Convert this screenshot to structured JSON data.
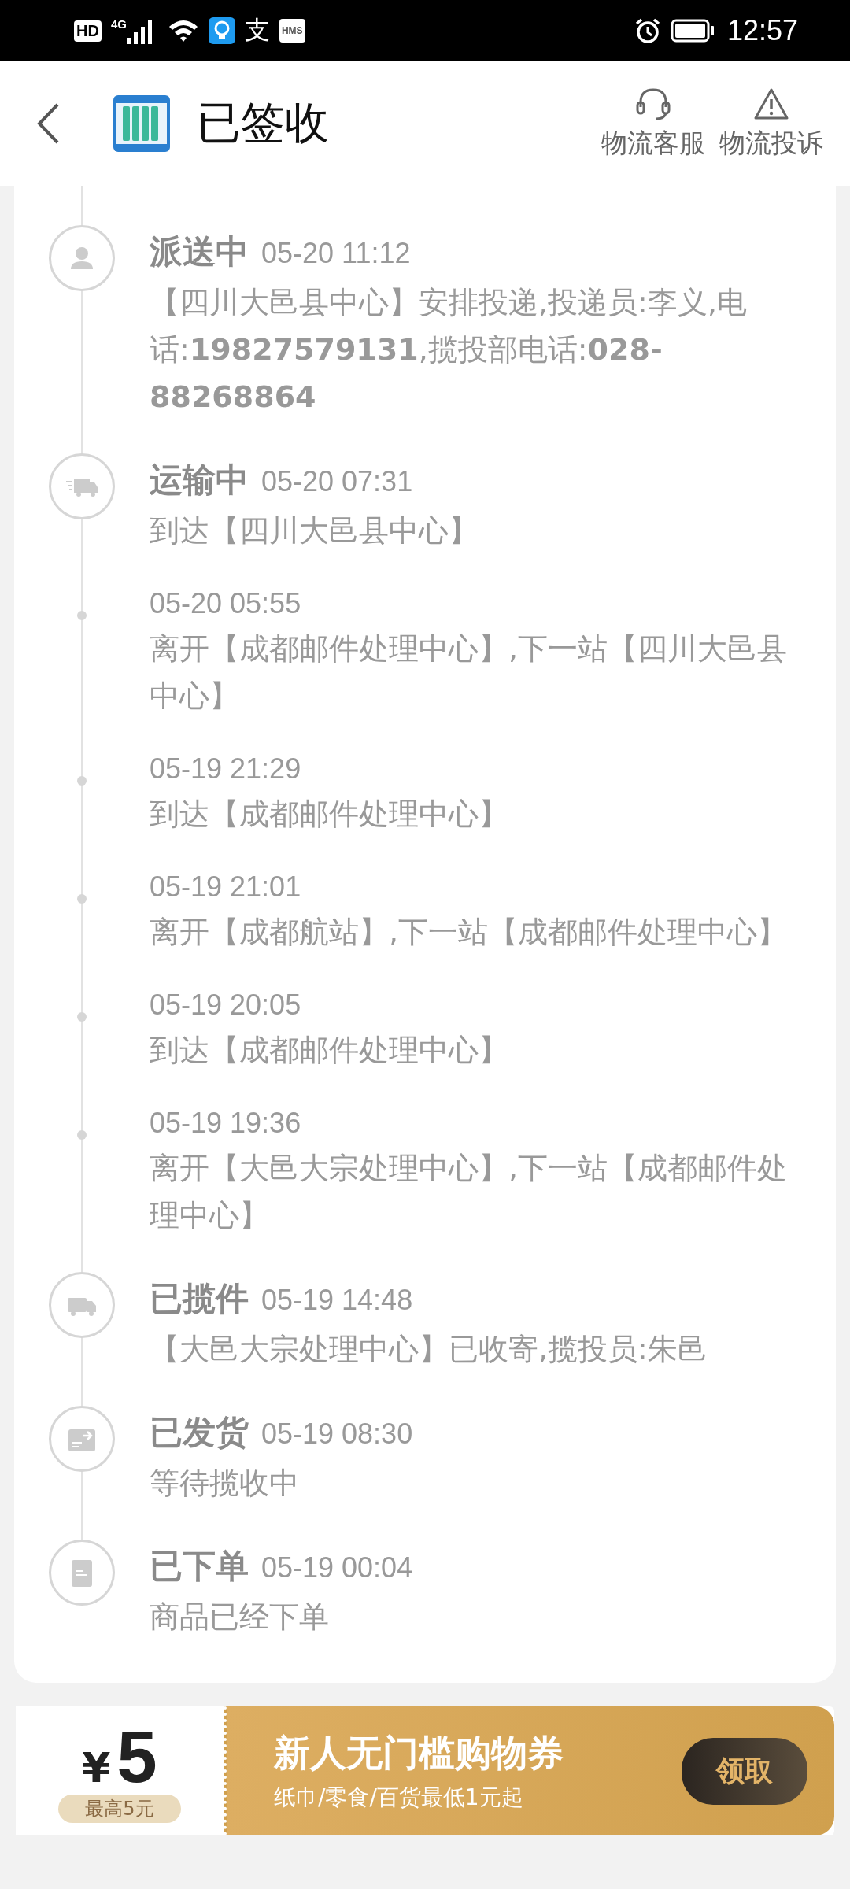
{
  "status_bar": {
    "badges": [
      "HD",
      "4G"
    ],
    "app_glyph": "支",
    "hms": "HMS",
    "time": "12:57"
  },
  "header": {
    "title": "已签收",
    "actions": [
      {
        "kind": "service",
        "label": "物流客服"
      },
      {
        "kind": "complaint",
        "label": "物流投诉"
      }
    ]
  },
  "events": [
    {
      "kind": "dispatch",
      "status": "派送中",
      "time": "05-20 11:12",
      "description": "【四川大邑县中心】安排投递,投递员:李义,电话:**19827579131**,揽投部电话:**028-88268864**"
    },
    {
      "kind": "transit",
      "status": "运输中",
      "time": "05-20 07:31",
      "description": "到达【四川大邑县中心】"
    },
    {
      "kind": "step",
      "time": "05-20 05:55",
      "description": "离开【成都邮件处理中心】,下一站【四川大邑县中心】"
    },
    {
      "kind": "step",
      "time": "05-19 21:29",
      "description": "到达【成都邮件处理中心】"
    },
    {
      "kind": "step",
      "time": "05-19 21:01",
      "description": "离开【成都航站】,下一站【成都邮件处理中心】"
    },
    {
      "kind": "step",
      "time": "05-19 20:05",
      "description": "到达【成都邮件处理中心】"
    },
    {
      "kind": "step",
      "time": "05-19 19:36",
      "description": "离开【大邑大宗处理中心】,下一站【成都邮件处理中心】"
    },
    {
      "kind": "pickup",
      "status": "已揽件",
      "time": "05-19 14:48",
      "description": "【大邑大宗处理中心】已收寄,揽投员:朱邑"
    },
    {
      "kind": "shipped",
      "status": "已发货",
      "time": "05-19 08:30",
      "description": "等待揽收中"
    },
    {
      "kind": "ordered",
      "status": "已下单",
      "time": "05-19 00:04",
      "description": "商品已经下单"
    }
  ],
  "coupon": {
    "currency": "¥",
    "amount": "5",
    "limit": "最高5元",
    "title": "新人无门槛购物券",
    "subtitle": "纸巾/零食/百货最低1元起",
    "button": "领取"
  }
}
